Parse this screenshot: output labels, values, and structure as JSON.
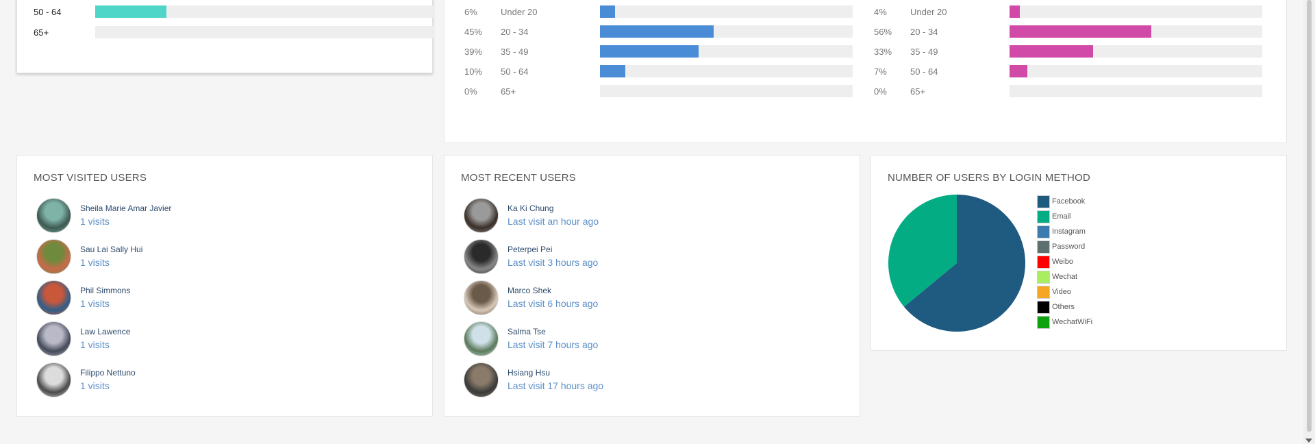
{
  "age_all": {
    "rows": [
      {
        "label": "50 - 64",
        "fraction": 0.21
      },
      {
        "label": "65+",
        "fraction": 0
      }
    ]
  },
  "age_gender": {
    "male": {
      "color": "#4a8cd6",
      "rows": [
        {
          "pct": "6%",
          "label": "Under 20",
          "value": 6
        },
        {
          "pct": "45%",
          "label": "20 - 34",
          "value": 45
        },
        {
          "pct": "39%",
          "label": "35 - 49",
          "value": 39
        },
        {
          "pct": "10%",
          "label": "50 - 64",
          "value": 10
        },
        {
          "pct": "0%",
          "label": "65+",
          "value": 0
        }
      ]
    },
    "female": {
      "color": "#d24aa8",
      "rows": [
        {
          "pct": "4%",
          "label": "Under 20",
          "value": 4
        },
        {
          "pct": "56%",
          "label": "20 - 34",
          "value": 56
        },
        {
          "pct": "33%",
          "label": "35 - 49",
          "value": 33
        },
        {
          "pct": "7%",
          "label": "50 - 64",
          "value": 7
        },
        {
          "pct": "0%",
          "label": "65+",
          "value": 0
        }
      ]
    }
  },
  "most_visited": {
    "title": "MOST VISITED USERS",
    "users": [
      {
        "name": "Sheila Marie Amar Javier",
        "sub": "1 visits"
      },
      {
        "name": "Sau Lai Sally Hui",
        "sub": "1 visits"
      },
      {
        "name": "Phil Simmons",
        "sub": "1 visits"
      },
      {
        "name": "Law Lawence",
        "sub": "1 visits"
      },
      {
        "name": "Filippo Nettuno",
        "sub": "1 visits"
      }
    ]
  },
  "most_recent": {
    "title": "MOST RECENT USERS",
    "users": [
      {
        "name": "Ka Ki Chung",
        "sub": "Last visit an hour ago"
      },
      {
        "name": "Peterpei Pei",
        "sub": "Last visit 3 hours ago"
      },
      {
        "name": "Marco Shek",
        "sub": "Last visit 6 hours ago"
      },
      {
        "name": "Salma Tse",
        "sub": "Last visit 7 hours ago"
      },
      {
        "name": "Hsiang Hsu",
        "sub": "Last visit 17 hours ago"
      }
    ]
  },
  "login": {
    "title": "NUMBER OF USERS BY LOGIN METHOD",
    "legend": [
      {
        "label": "Facebook",
        "color": "#1f5a80"
      },
      {
        "label": "Email",
        "color": "#03ac83"
      },
      {
        "label": "Instagram",
        "color": "#3b7bb0"
      },
      {
        "label": "Password",
        "color": "#5c7070"
      },
      {
        "label": "Weibo",
        "color": "#ff0000"
      },
      {
        "label": "Wechat",
        "color": "#a8ee60"
      },
      {
        "label": "Video",
        "color": "#f5a623"
      },
      {
        "label": "Others",
        "color": "#000000"
      },
      {
        "label": "WechatWiFi",
        "color": "#0ea20e"
      }
    ]
  },
  "chart_data": {
    "type": "pie",
    "title": "NUMBER OF USERS BY LOGIN METHOD",
    "categories": [
      "Facebook",
      "Email",
      "Instagram",
      "Password",
      "Weibo",
      "Wechat",
      "Video",
      "Others",
      "WechatWiFi"
    ],
    "values": [
      64,
      36,
      0,
      0,
      0,
      0,
      0,
      0,
      0
    ],
    "colors": [
      "#1f5a80",
      "#03ac83",
      "#3b7bb0",
      "#5c7070",
      "#ff0000",
      "#a8ee60",
      "#f5a623",
      "#000000",
      "#0ea20e"
    ],
    "legend": "right"
  },
  "avatars": [
    {
      "c1": "#7fb3a8",
      "c2": "#3e5a52"
    },
    {
      "c1": "#6e8a3c",
      "c2": "#c86a4a"
    },
    {
      "c1": "#c9573a",
      "c2": "#2f5f8a"
    },
    {
      "c1": "#b9b9c7",
      "c2": "#444a5a"
    },
    {
      "c1": "#dcdcdc",
      "c2": "#4a4a4a"
    },
    {
      "c1": "#9a9a9a",
      "c2": "#3a2f28"
    },
    {
      "c1": "#2a2a2a",
      "c2": "#888888"
    },
    {
      "c1": "#6a5a4a",
      "c2": "#d8c8b8"
    },
    {
      "c1": "#cfe0e8",
      "c2": "#5a7a5a"
    },
    {
      "c1": "#8a7a6a",
      "c2": "#3a3a3a"
    }
  ]
}
